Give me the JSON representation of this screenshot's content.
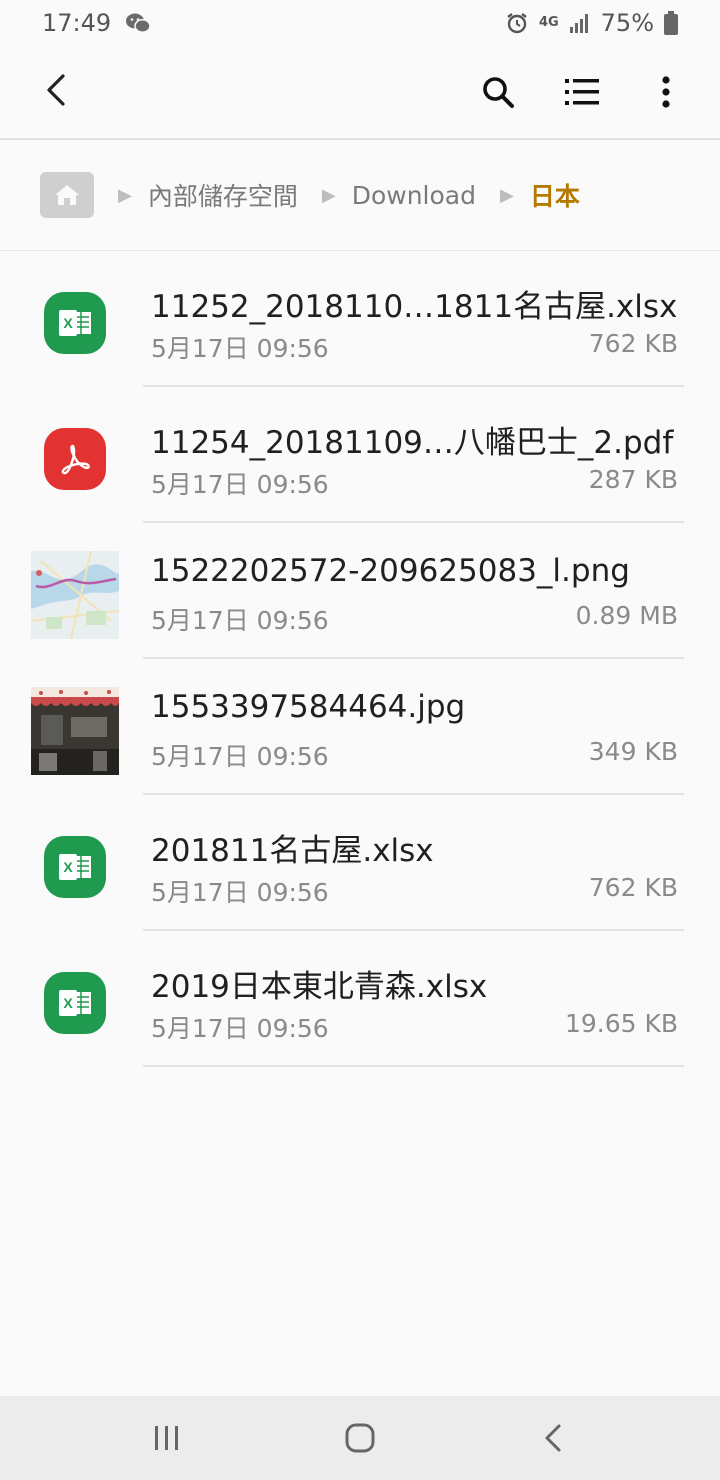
{
  "status_bar": {
    "time": "17:49",
    "network": "4G",
    "battery": "75%",
    "icons": [
      "wechat-icon",
      "alarm-icon",
      "signal-icon",
      "battery-icon"
    ]
  },
  "app_bar": {
    "back_icon": "back-arrow-icon",
    "actions": [
      "search-icon",
      "list-view-icon",
      "more-options-icon"
    ]
  },
  "breadcrumb": {
    "home_icon": "home-folder-icon",
    "items": [
      "內部儲存空間",
      "Download",
      "日本"
    ],
    "current_color": "#b47a00"
  },
  "files": [
    {
      "name": "11252_2018110…1811名古屋.xlsx",
      "date": "5月17日 09:56",
      "size": "762 KB",
      "icon": "excel-file-icon"
    },
    {
      "name": "11254_20181109…八幡巴士_2.pdf",
      "date": "5月17日 09:56",
      "size": "287 KB",
      "icon": "pdf-file-icon"
    },
    {
      "name": "1522202572-209625083_l.png",
      "date": "5月17日 09:56",
      "size": "0.89 MB",
      "icon": "map-image-thumbnail"
    },
    {
      "name": "1553397584464.jpg",
      "date": "5月17日 09:56",
      "size": "349 KB",
      "icon": "photo-thumbnail"
    },
    {
      "name": "201811名古屋.xlsx",
      "date": "5月17日 09:56",
      "size": "762 KB",
      "icon": "excel-file-icon"
    },
    {
      "name": "2019日本東北青森.xlsx",
      "date": "5月17日 09:56",
      "size": "19.65 KB",
      "icon": "excel-file-icon"
    }
  ],
  "nav_bar": {
    "buttons": [
      "recent-apps-icon",
      "home-icon",
      "back-icon"
    ]
  },
  "colors": {
    "excel": "#1f9a4f",
    "pdf": "#e23232",
    "accent": "#b47a00"
  }
}
